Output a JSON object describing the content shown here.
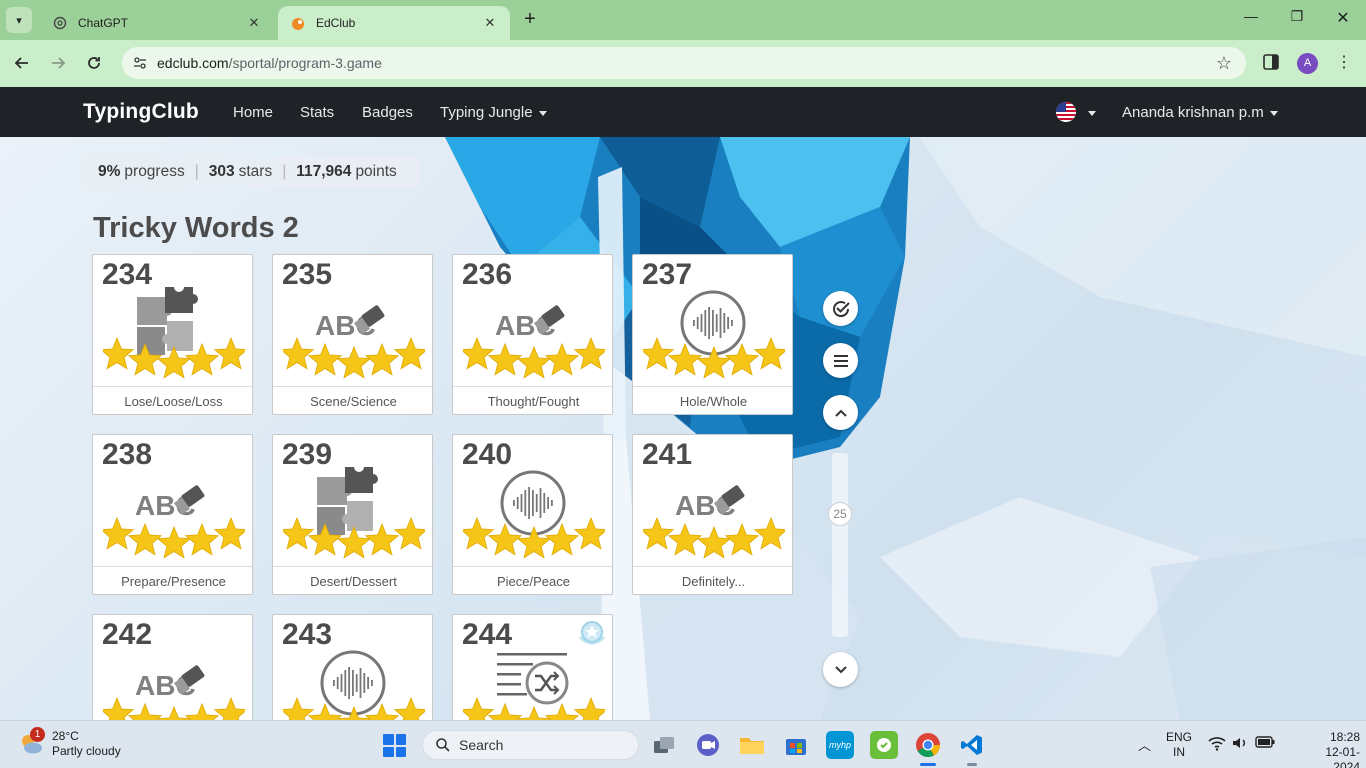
{
  "browser": {
    "tabs": [
      {
        "label": "ChatGPT",
        "active": false,
        "icon": "chatgpt-icon"
      },
      {
        "label": "EdClub",
        "active": true,
        "icon": "edclub-icon"
      }
    ],
    "url_domain": "edclub.com",
    "url_path": "/sportal/program-3.game",
    "profile_initial": "A"
  },
  "site": {
    "logo": "TypingClub",
    "nav": {
      "home": "Home",
      "stats": "Stats",
      "badges": "Badges",
      "jungle": "Typing Jungle"
    },
    "user_name": "Ananda krishnan p.m"
  },
  "progress": {
    "percent": "9%",
    "percent_label": "progress",
    "stars": "303",
    "stars_label": "stars",
    "points": "117,964",
    "points_label": "points"
  },
  "section_title": "Tricky Words 2",
  "lessons": [
    {
      "num": "234",
      "label": "Lose/Loose/Loss",
      "icon": "puzzle-icon",
      "stars": 5
    },
    {
      "num": "235",
      "label": "Scene/Science",
      "icon": "abc-eraser-icon",
      "stars": 5
    },
    {
      "num": "236",
      "label": "Thought/Fought",
      "icon": "abc-eraser-icon",
      "stars": 5
    },
    {
      "num": "237",
      "label": "Hole/Whole",
      "icon": "audio-wave-icon",
      "stars": 5
    },
    {
      "num": "238",
      "label": "Prepare/Presence",
      "icon": "abc-eraser-icon",
      "stars": 5
    },
    {
      "num": "239",
      "label": "Desert/Dessert",
      "icon": "puzzle-icon",
      "stars": 5
    },
    {
      "num": "240",
      "label": "Piece/Peace",
      "icon": "audio-wave-icon",
      "stars": 5
    },
    {
      "num": "241",
      "label": "Definitely...",
      "icon": "abc-eraser-icon",
      "stars": 5
    },
    {
      "num": "242",
      "label": "",
      "icon": "abc-eraser-icon",
      "stars": 5
    },
    {
      "num": "243",
      "label": "",
      "icon": "audio-wave-icon",
      "stars": 5
    },
    {
      "num": "244",
      "label": "",
      "icon": "shuffle-list-icon",
      "stars": 5,
      "badge": "award-badge-icon"
    }
  ],
  "slider_value": "25",
  "taskbar": {
    "temperature": "28°C",
    "weather": "Partly cloudy",
    "notification_count": "1",
    "search_label": "Search",
    "lang_line1": "ENG",
    "lang_line2": "IN",
    "time": "18:28",
    "date": "12-01-2024"
  },
  "colors": {
    "tab_strip": "#9bd099",
    "toolbar": "#cbeeca",
    "site_nav": "#1f2327",
    "accent_blue": "#1a73e8",
    "star_gold": "#f5c518"
  }
}
